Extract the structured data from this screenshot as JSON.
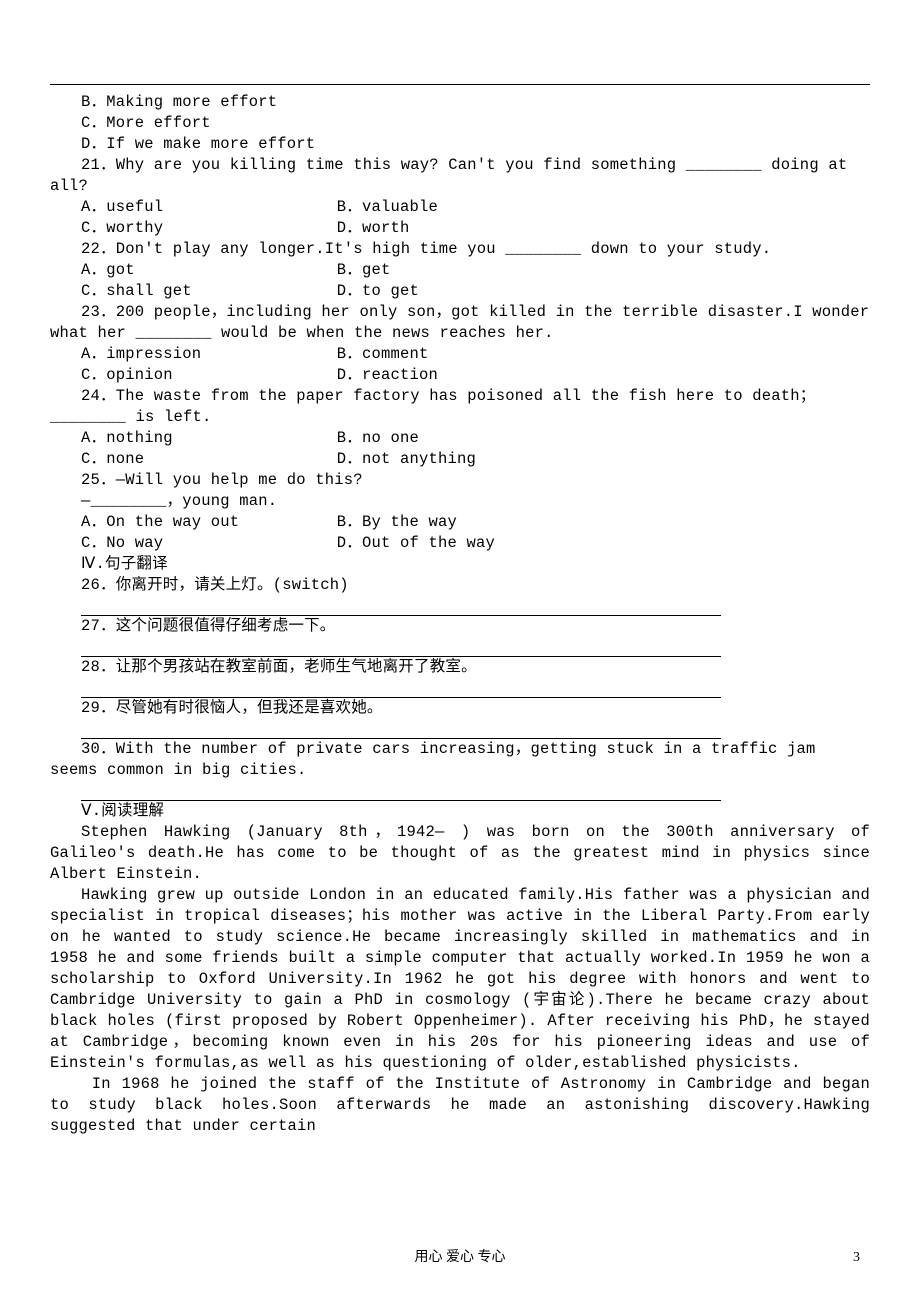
{
  "lines": {
    "b_opt": "B．Making more effort",
    "c_opt": "C．More effort",
    "d_opt": "D．If we make more effort",
    "q21": "21．Why are you killing time this way? Can't you find something ________ doing at all?",
    "q21a": "A．useful",
    "q21b": "B．valuable",
    "q21c": "C．worthy",
    "q21d": "D．worth",
    "q22": "22．Don't play any longer.It's high time you ________ down to your study.",
    "q22a": "A．got",
    "q22b": "B．get",
    "q22c": "C．shall get",
    "q22d": "D．to get",
    "q23": "23．200 people，including her only son，got killed in the terrible disaster.I wonder what her ________ would be when the news reaches her.",
    "q23a": "A．impression",
    "q23b": "B．comment",
    "q23c": "C．opinion",
    "q23d": "D．reaction",
    "q24": "24．The waste from the paper factory has poisoned all the fish here to death；________ is left.",
    "q24a": "A．nothing",
    "q24b": "B．no one",
    "q24c": "C．none",
    "q24d": "D．not anything",
    "q25": "25．—Will you help me do this?",
    "q25r": "—________，young man.",
    "q25a": "A．On the way out",
    "q25b": "B．By the way",
    "q25c": "C．No way",
    "q25d": "D．Out of the way",
    "sec4": "Ⅳ.句子翻译",
    "t26": "26．你离开时，请关上灯。(switch)",
    "t27": "27．这个问题很值得仔细考虑一下。",
    "t28": "28．让那个男孩站在教室前面，老师生气地离开了教室。",
    "t29": "29．尽管她有时很恼人，但我还是喜欢她。",
    "t30": "30．With the number of private cars increasing，getting stuck in a traffic jam seems common in big cities.",
    "sec5": "Ⅴ.阅读理解",
    "p1": "Stephen Hawking (January 8th，1942— ) was born on the 300th anniversary of Galileo's death.He has come to be thought of as the greatest mind in physics since Albert Einstein.",
    "p2": "Hawking grew up outside London in an educated family.His father was a physician and specialist in tropical diseases；his mother was active in the Liberal Party.From early on he wanted to study science.He became increasingly skilled in mathematics and in 1958 he and some friends built a simple computer that actually worked.In 1959 he won a scholarship to Oxford University.In 1962 he got his degree with honors and went to Cambridge University to gain a PhD in cosmology (宇宙论).There he became crazy about black holes (first proposed by Robert Oppenheimer). After receiving his PhD，he stayed at Cambridge，becoming known even in his 20s for his pioneering ideas and use of Einstein's formulas,as well as his questioning of older,established physicists.",
    "p3": " In 1968 he joined the staff of the Institute of Astronomy in Cambridge and began to study black holes.Soon afterwards he made an astonishing discovery.Hawking suggested that under certain"
  },
  "footer": {
    "motto": "用心 爱心 专心",
    "page_number": "3"
  }
}
